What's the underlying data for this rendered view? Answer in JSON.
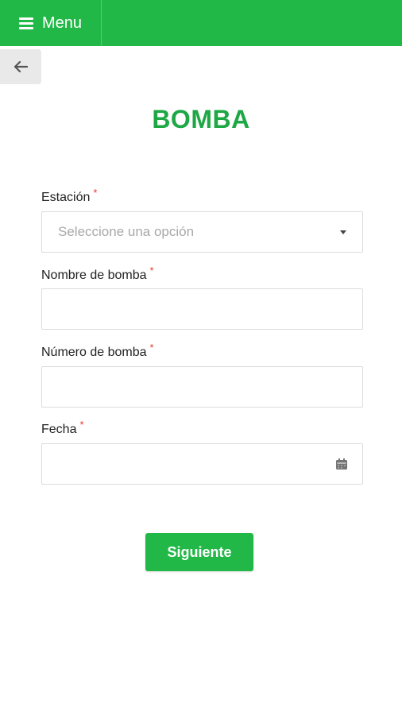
{
  "header": {
    "menu_label": "Menu",
    "menu_icon": "hamburger-icon",
    "color": "#22b847"
  },
  "nav": {
    "back_icon": "arrow-left-icon"
  },
  "page": {
    "title": "BOMBA",
    "title_color": "#1ea845"
  },
  "form": {
    "station": {
      "label": "Estación",
      "required_mark": "*",
      "placeholder": "Seleccione una opción",
      "value": ""
    },
    "pump_name": {
      "label": "Nombre de bomba",
      "required_mark": "*",
      "value": ""
    },
    "pump_number": {
      "label": "Número de bomba",
      "required_mark": "*",
      "value": ""
    },
    "date": {
      "label": "Fecha",
      "required_mark": "*",
      "value": "",
      "icon": "calendar-icon"
    },
    "submit_label": "Siguiente"
  }
}
